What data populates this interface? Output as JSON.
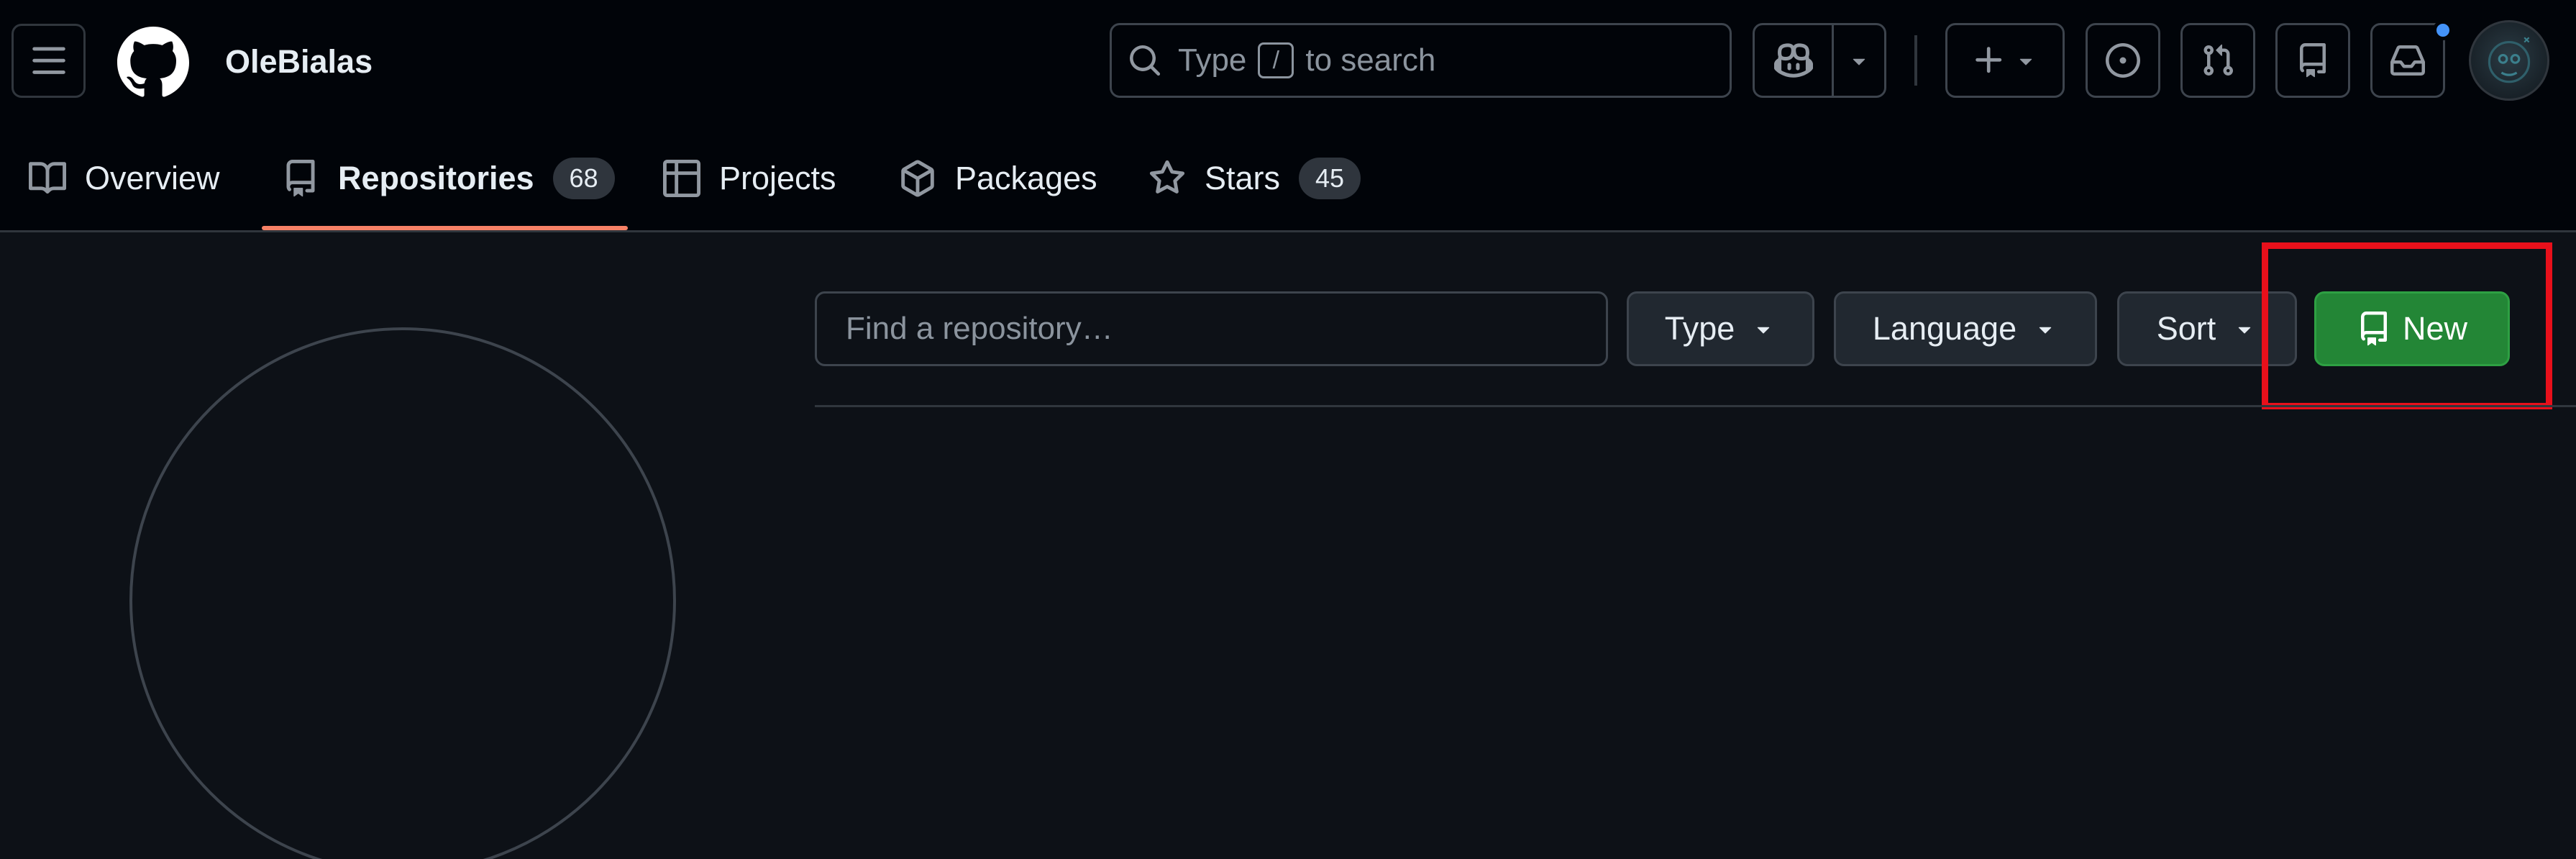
{
  "header": {
    "username": "OleBialas",
    "search": {
      "prefix": "Type",
      "key": "/",
      "suffix": "to search"
    },
    "icons": [
      "menu-icon",
      "github-logo-icon",
      "copilot-icon",
      "plus-icon",
      "issues-icon",
      "pull-requests-icon",
      "repo-icon",
      "inbox-icon"
    ]
  },
  "tabs": [
    {
      "label": "Overview",
      "icon": "book-icon"
    },
    {
      "label": "Repositories",
      "icon": "repo-icon",
      "count": "68",
      "active": true
    },
    {
      "label": "Projects",
      "icon": "table-icon"
    },
    {
      "label": "Packages",
      "icon": "package-icon"
    },
    {
      "label": "Stars",
      "icon": "star-icon",
      "count": "45"
    }
  ],
  "repo_toolbar": {
    "find_placeholder": "Find a repository…",
    "type_label": "Type",
    "language_label": "Language",
    "sort_label": "Sort",
    "new_label": "New"
  },
  "colors": {
    "background": "#0d1117",
    "header_background": "#010409",
    "accent_underline": "#f78166",
    "new_button": "#238636",
    "highlight": "#e8101b",
    "notification": "#4493f8"
  }
}
